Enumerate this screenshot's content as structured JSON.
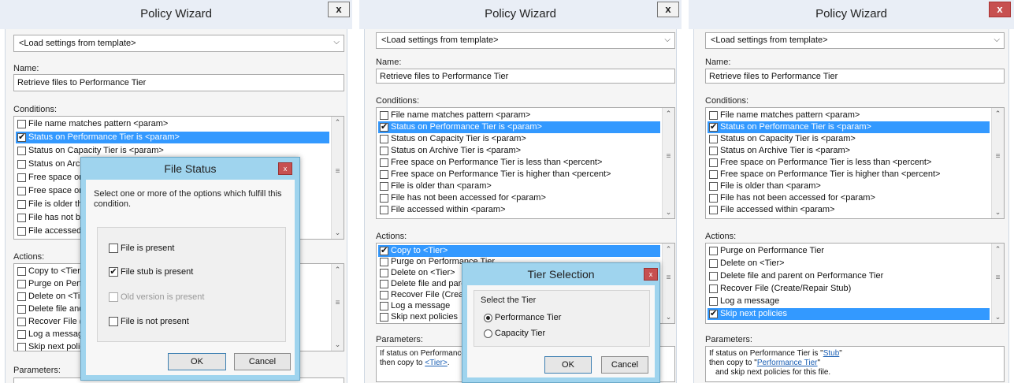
{
  "panel1": {
    "title": "Policy Wizard",
    "close": "x",
    "template": "<Load settings from template>",
    "name_label": "Name:",
    "name_value": "Retrieve files to Performance Tier",
    "conditions_label": "Conditions:",
    "conditions": [
      {
        "label": "File name matches pattern <param>",
        "checked": false
      },
      {
        "label": "Status on Performance Tier is <param>",
        "checked": true,
        "selected": true
      },
      {
        "label": "Status on Capacity Tier is <param>",
        "checked": false
      },
      {
        "label": "Status on Arch",
        "checked": false
      },
      {
        "label": "Free space on",
        "checked": false
      },
      {
        "label": "Free space on",
        "checked": false
      },
      {
        "label": "File is older th",
        "checked": false
      },
      {
        "label": "File has not be",
        "checked": false
      },
      {
        "label": "File accessed",
        "checked": false
      }
    ],
    "actions_label": "Actions:",
    "actions": [
      {
        "label": "Copy to <Tier",
        "checked": false
      },
      {
        "label": "Purge on Perf",
        "checked": false
      },
      {
        "label": "Delete on <Ti",
        "checked": false
      },
      {
        "label": "Delete file and",
        "checked": false
      },
      {
        "label": "Recover File (",
        "checked": false
      },
      {
        "label": "Log a messag",
        "checked": false
      },
      {
        "label": "Skip next polic",
        "checked": false
      }
    ],
    "parameters_label": "Parameters:"
  },
  "file_status": {
    "title": "File Status",
    "close": "x",
    "instruction": "Select one or more of the options which fulfill this condition.",
    "options": [
      {
        "label": "File is present",
        "checked": false,
        "disabled": false
      },
      {
        "label": "File stub is present",
        "checked": true,
        "disabled": false
      },
      {
        "label": "Old version is present",
        "checked": false,
        "disabled": true
      },
      {
        "label": "File is not present",
        "checked": false,
        "disabled": false
      }
    ],
    "ok": "OK",
    "cancel": "Cancel"
  },
  "panel2": {
    "title": "Policy Wizard",
    "close": "x",
    "template": "<Load settings from template>",
    "name_label": "Name:",
    "name_value": "Retrieve files to Performance Tier",
    "conditions_label": "Conditions:",
    "conditions": [
      {
        "label": "File name matches pattern <param>",
        "checked": false
      },
      {
        "label": "Status on Performance Tier is <param>",
        "checked": true,
        "selected": true
      },
      {
        "label": "Status on Capacity Tier is <param>",
        "checked": false
      },
      {
        "label": "Status on Archive Tier is <param>",
        "checked": false
      },
      {
        "label": "Free space on Performance Tier is less than <percent>",
        "checked": false
      },
      {
        "label": "Free space on Performance Tier is higher than <percent>",
        "checked": false
      },
      {
        "label": "File is older than <param>",
        "checked": false
      },
      {
        "label": "File has not been accessed for <param>",
        "checked": false
      },
      {
        "label": "File accessed within <param>",
        "checked": false
      }
    ],
    "actions_label": "Actions:",
    "actions": [
      {
        "label": "Copy to <Tier>",
        "checked": true,
        "selected": true
      },
      {
        "label": "Purge on Performance Tier",
        "checked": false
      },
      {
        "label": "Delete on <Tier>",
        "checked": false
      },
      {
        "label": "Delete file and parent o",
        "checked": false
      },
      {
        "label": "Recover File (Create/R",
        "checked": false
      },
      {
        "label": "Log a message",
        "checked": false
      },
      {
        "label": "Skip next policies",
        "checked": false
      }
    ],
    "parameters_label": "Parameters:",
    "params_line1": "If status on Performance",
    "params_line2_prefix": "then copy to ",
    "params_line2_link": "<Tier>",
    "params_line2_suffix": "."
  },
  "tier_selection": {
    "title": "Tier Selection",
    "close": "x",
    "group_label": "Select the Tier",
    "options": [
      {
        "label": "Performance Tier",
        "checked": true
      },
      {
        "label": "Capacity Tier",
        "checked": false
      }
    ],
    "ok": "OK",
    "cancel": "Cancel"
  },
  "panel3": {
    "title": "Policy Wizard",
    "close": "x",
    "template": "<Load settings from template>",
    "name_label": "Name:",
    "name_value": "Retrieve files to Performance Tier",
    "conditions_label": "Conditions:",
    "conditions": [
      {
        "label": "File name matches pattern <param>",
        "checked": false
      },
      {
        "label": "Status on Performance Tier is <param>",
        "checked": true,
        "selected": true
      },
      {
        "label": "Status on Capacity Tier is <param>",
        "checked": false
      },
      {
        "label": "Status on Archive Tier is <param>",
        "checked": false
      },
      {
        "label": "Free space on Performance Tier is less than <percent>",
        "checked": false
      },
      {
        "label": "Free space on Performance Tier is higher than <percent>",
        "checked": false
      },
      {
        "label": "File is older than <param>",
        "checked": false
      },
      {
        "label": "File has not been accessed for <param>",
        "checked": false
      },
      {
        "label": "File accessed within <param>",
        "checked": false
      }
    ],
    "actions_label": "Actions:",
    "actions": [
      {
        "label": "Purge on Performance Tier",
        "checked": false
      },
      {
        "label": "Delete on <Tier>",
        "checked": false
      },
      {
        "label": "Delete file and parent on Performance Tier",
        "checked": false
      },
      {
        "label": "Recover File (Create/Repair Stub)",
        "checked": false
      },
      {
        "label": "Log a message",
        "checked": false
      },
      {
        "label": "Skip next policies",
        "checked": true,
        "selected": true
      }
    ],
    "parameters_label": "Parameters:",
    "params_line1_prefix": "If status on Performance Tier is \"",
    "params_line1_link": "Stub",
    "params_line1_suffix": "\"",
    "params_line2_prefix": "then copy to \"",
    "params_line2_link": "Performance Tier",
    "params_line2_suffix": "\"",
    "params_line3": "and skip next policies for this file."
  },
  "icons": {
    "checkmark": "✔",
    "dropdown": "⌵",
    "scroll_up": "⌃",
    "scroll_down": "⌄",
    "scroll_grip": "≡"
  }
}
